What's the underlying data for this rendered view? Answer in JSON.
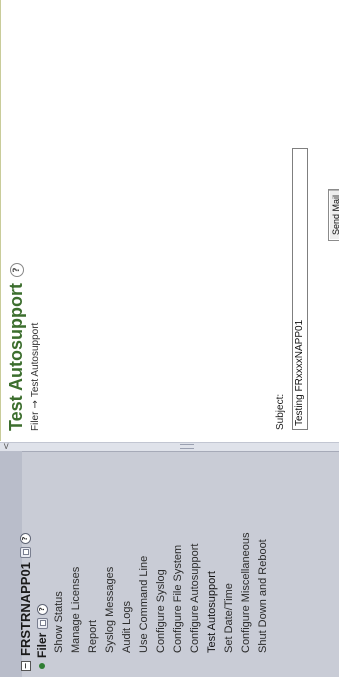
{
  "nav": {
    "root_label": "FRSTRNAPP01",
    "filer_label": "Filer",
    "items": [
      "Show Status",
      "Manage Licenses",
      "Report",
      "Syslog Messages",
      "Audit Logs",
      "Use Command Line",
      "Configure Syslog",
      "Configure File System",
      "Configure Autosupport",
      "Test Autosupport",
      "Set Date/Time",
      "Configure Miscellaneous",
      "Shut Down and Reboot"
    ]
  },
  "page": {
    "title": "Test Autosupport",
    "breadcrumb": {
      "parent": "Filer",
      "arrow": "→",
      "current": "Test Autosupport"
    }
  },
  "form": {
    "subject_label": "Subject:",
    "subject_value": "Testing FRxxxxNAPP01",
    "send_button": "Send Mail"
  },
  "icons": {
    "help": "?",
    "expander": "−",
    "splitter_arrow": "<"
  },
  "colors": {
    "title": "#3c6e2e",
    "nav_bg": "#c9ccd6",
    "active_bullet": "#2e7d32"
  }
}
